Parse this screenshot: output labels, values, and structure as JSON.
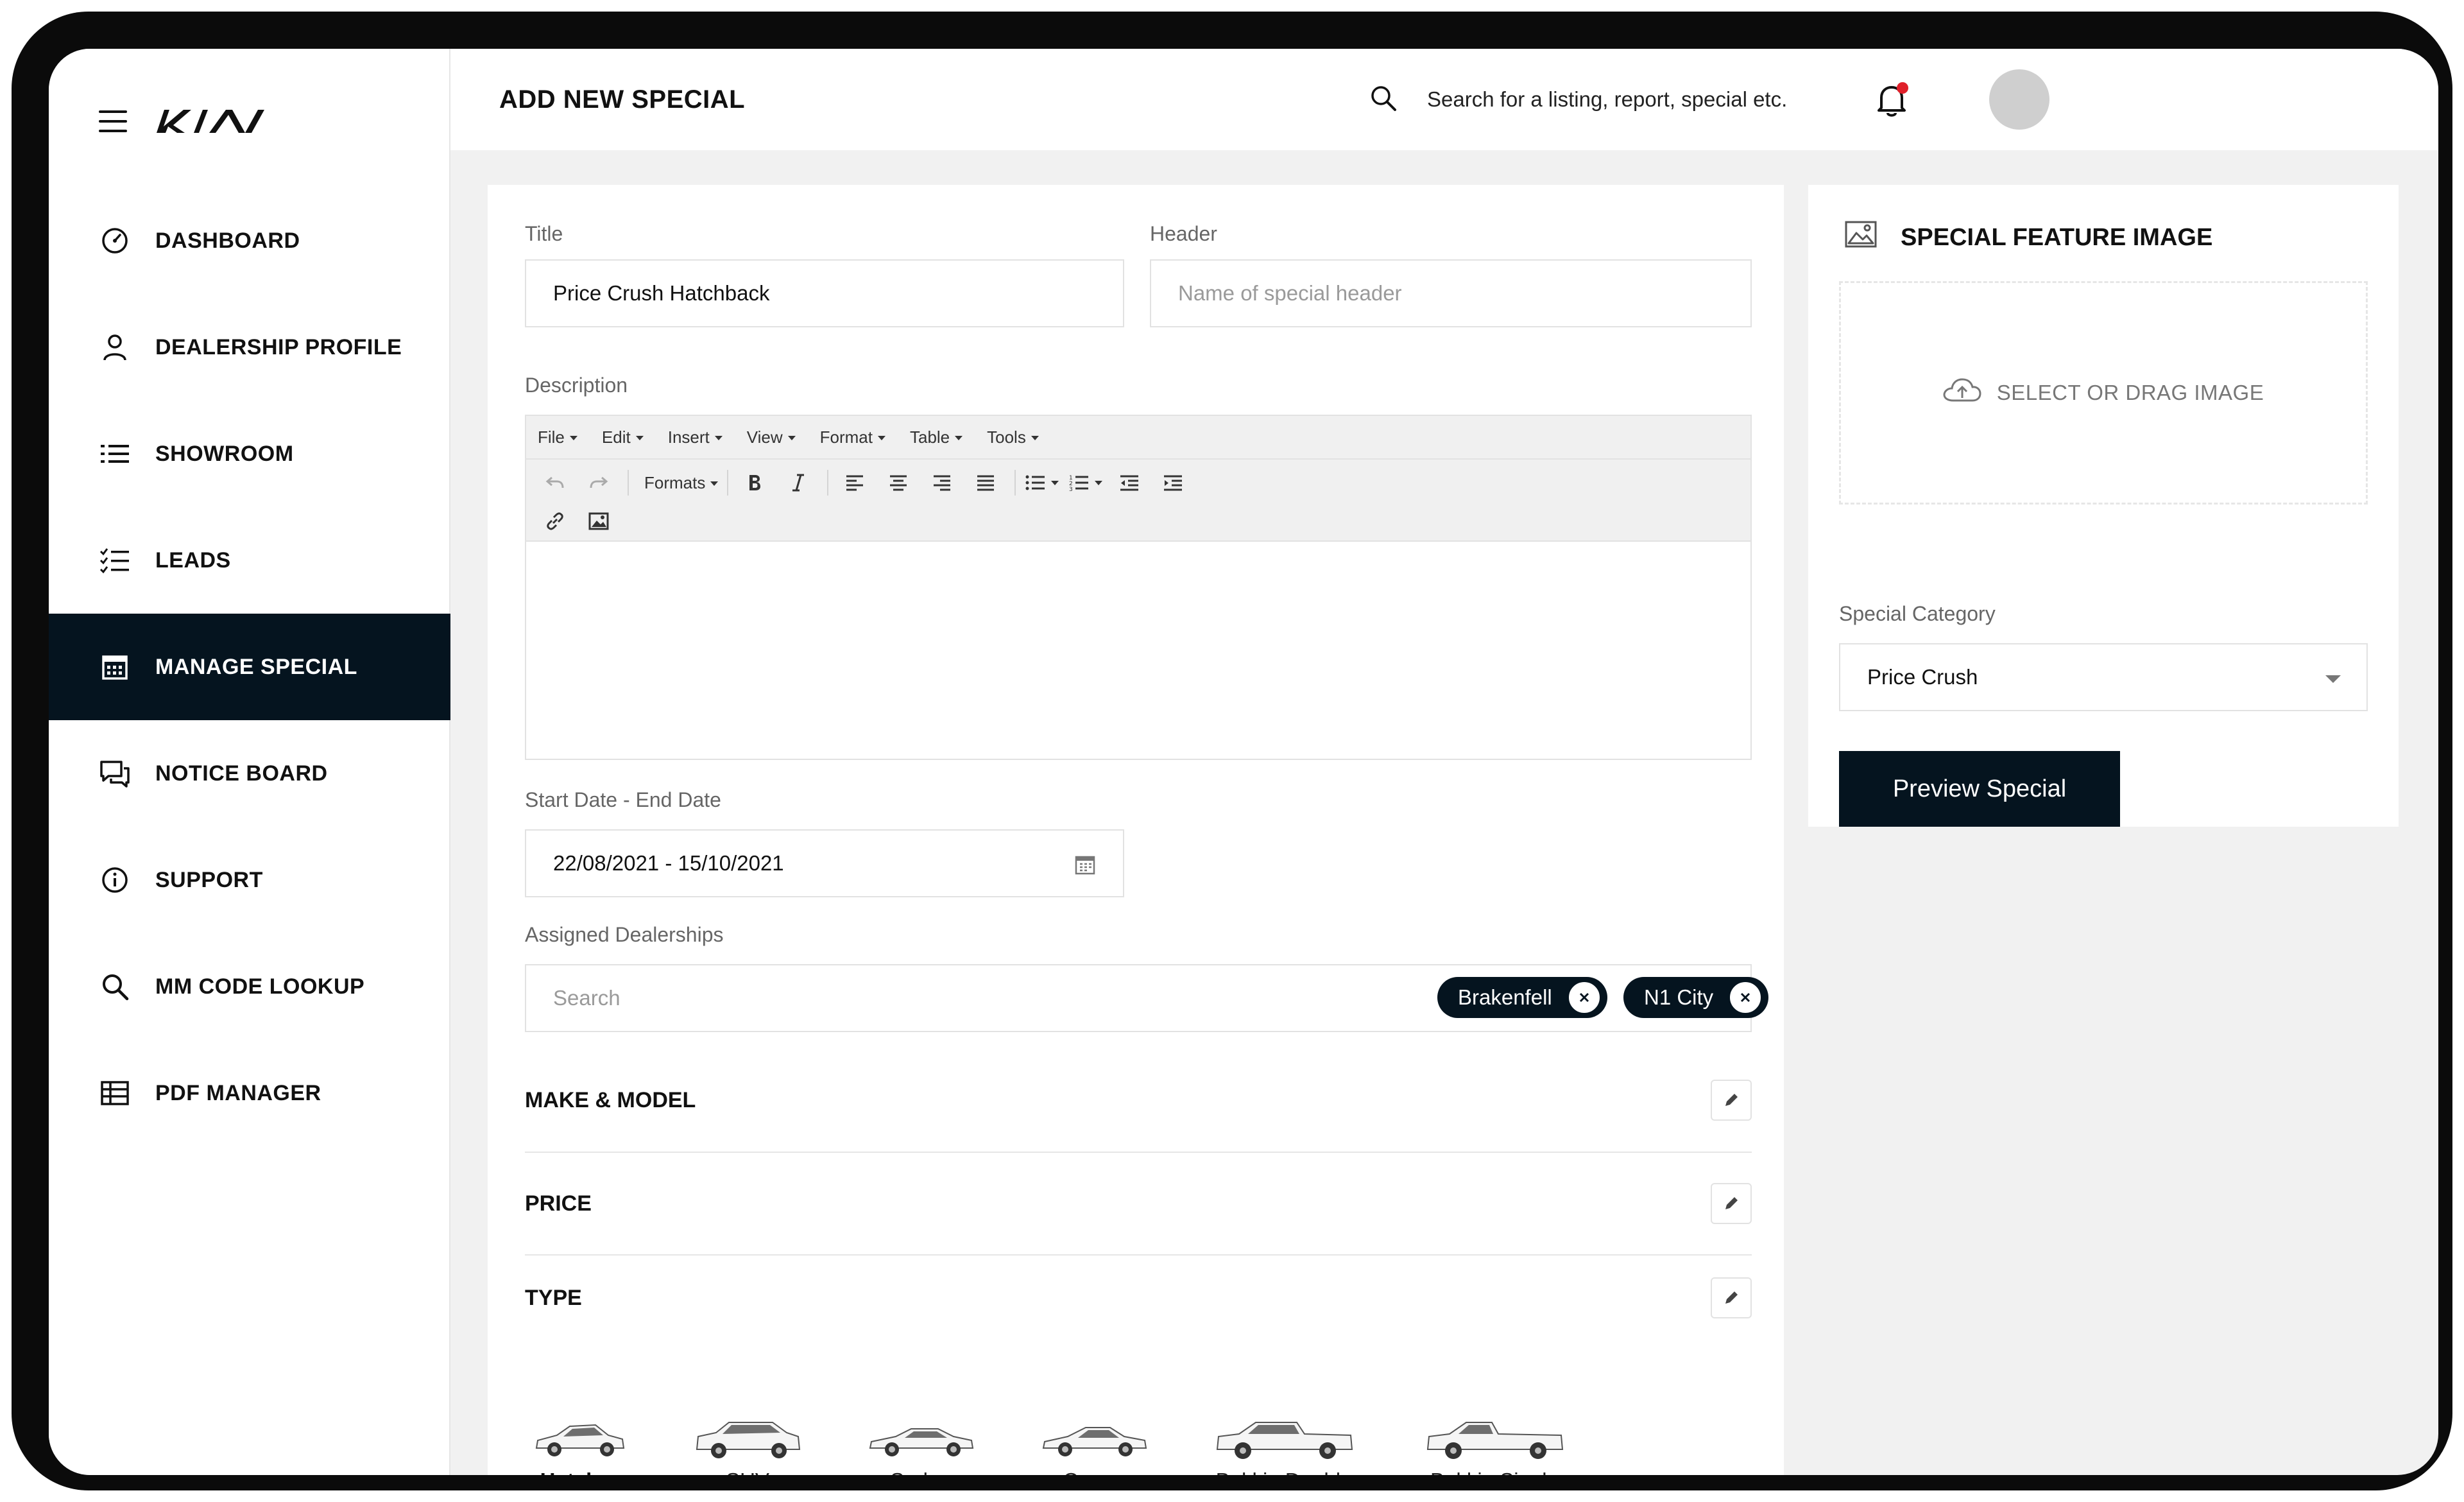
{
  "app": {
    "brand": "KIA"
  },
  "sidebar": {
    "items": [
      {
        "label": "DASHBOARD",
        "icon": "dashboard-gauge-icon"
      },
      {
        "label": "DEALERSHIP PROFILE",
        "icon": "user-icon"
      },
      {
        "label": "SHOWROOM",
        "icon": "list-icon"
      },
      {
        "label": "LEADS",
        "icon": "checklist-icon"
      },
      {
        "label": "MANAGE SPECIAL",
        "icon": "calendar-icon",
        "active": true
      },
      {
        "label": "NOTICE BOARD",
        "icon": "chat-bubbles-icon"
      },
      {
        "label": "SUPPORT",
        "icon": "info-icon"
      },
      {
        "label": "MM CODE LOOKUP",
        "icon": "search-icon"
      },
      {
        "label": "PDF MANAGER",
        "icon": "table-icon"
      }
    ]
  },
  "header": {
    "title": "ADD NEW SPECIAL",
    "search_text": "Search for a listing, report, special etc."
  },
  "form": {
    "title_label": "Title",
    "title_value": "Price Crush Hatchback",
    "header_label": "Header",
    "header_placeholder": "Name of special header",
    "description_label": "Description",
    "editor_menu": [
      "File",
      "Edit",
      "Insert",
      "View",
      "Format",
      "Table",
      "Tools"
    ],
    "editor_formats": "Formats",
    "dates_label": "Start Date - End Date",
    "dates_value": "22/08/2021 - 15/10/2021",
    "dealerships_label": "Assigned Dealerships",
    "dealerships_placeholder": "Search",
    "dealerships_tags": [
      "Brakenfell",
      "N1 City"
    ],
    "sections": [
      "MAKE & MODEL",
      "PRICE",
      "TYPE"
    ],
    "types": [
      {
        "label": "Hatch",
        "selected": true
      },
      {
        "label": "SUV"
      },
      {
        "label": "Sedan"
      },
      {
        "label": "Coupe"
      },
      {
        "label": "Bakkie Double"
      },
      {
        "label": "Bakkie Single"
      }
    ]
  },
  "side": {
    "image_title": "SPECIAL FEATURE IMAGE",
    "drop_text": "SELECT OR DRAG IMAGE",
    "category_label": "Special Category",
    "category_value": "Price Crush",
    "preview_button": "Preview Special"
  },
  "colors": {
    "primary": "#05141f",
    "accent_red": "#e0202a"
  }
}
